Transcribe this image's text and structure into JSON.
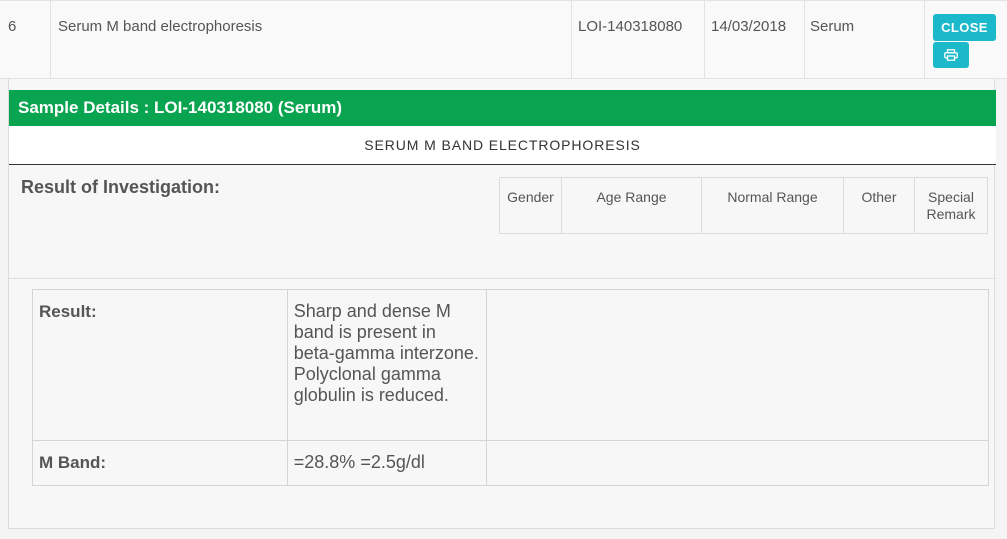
{
  "row": {
    "index": "6",
    "test_name": "Serum M band electrophoresis",
    "loi": "LOI-140318080",
    "date": "14/03/2018",
    "sample_type": "Serum",
    "close_label": "CLOSE",
    "print_icon": "print-icon"
  },
  "details": {
    "header": "Sample Details : LOI-140318080 (Serum)",
    "test_title": "SERUM M BAND ELECTROPHORESIS",
    "result_of_investigation_label": "Result of Investigation:",
    "reference_columns": [
      "Gender",
      "Age Range",
      "Normal Range",
      "Other",
      "Special Remark"
    ],
    "results": [
      {
        "label": "Result:",
        "value": "Sharp and dense M band is present in beta-gamma interzone. Polyclonal gamma globulin is reduced."
      },
      {
        "label": "M Band:",
        "value": "=28.8% =2.5g/dl"
      }
    ]
  },
  "colors": {
    "accent_button": "#1bb9c9",
    "header_green": "#09a450"
  }
}
